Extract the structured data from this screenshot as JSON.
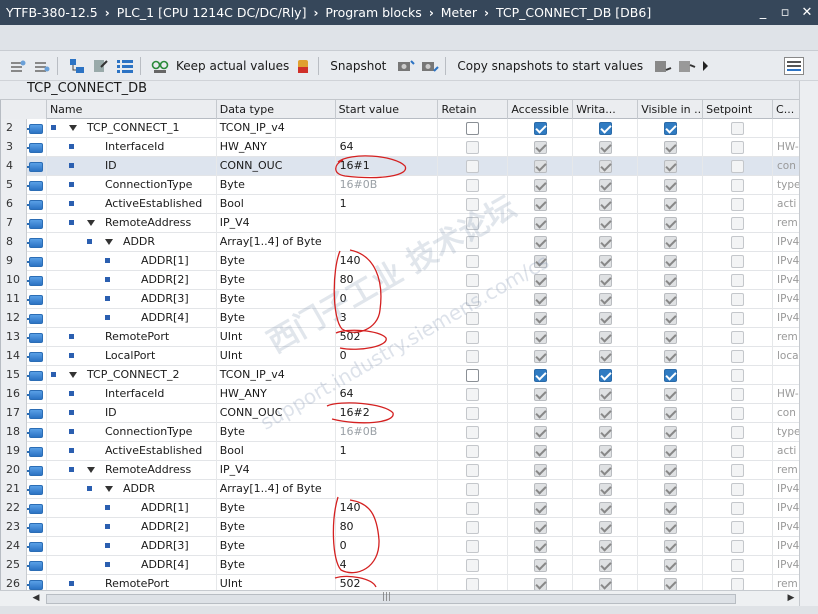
{
  "breadcrumb": [
    "YTFB-380-12.5",
    "PLC_1 [CPU 1214C DC/DC/Rly]",
    "Program blocks",
    "Meter",
    "TCP_CONNECT_DB [DB6]"
  ],
  "window_controls": {
    "minimize": "_",
    "restore": "▫",
    "close": "✕"
  },
  "toolbar": {
    "keep_actual": "Keep actual values",
    "snapshot": "Snapshot",
    "copy_snapshots": "Copy snapshots to start values"
  },
  "db_title": "TCP_CONNECT_DB",
  "columns": [
    "Name",
    "Data type",
    "Start value",
    "Retain",
    "Accessible f...",
    "Writa...",
    "Visible in ...",
    "Setpoint",
    "C..."
  ],
  "rows": [
    {
      "num": "2",
      "name": "TCP_CONNECT_1",
      "level": 0,
      "expand": true,
      "type": "TCON_IP_v4",
      "start": "",
      "grey": false,
      "retain": "box",
      "acc": "on",
      "wr": "on",
      "vis": "on",
      "set": "dis",
      "extra": ""
    },
    {
      "num": "3",
      "name": "InterfaceId",
      "level": 1,
      "expand": false,
      "type": "HW_ANY",
      "start": "64",
      "grey": false,
      "retain": "dis",
      "acc": "ondis",
      "wr": "ondis",
      "vis": "ondis",
      "set": "dis",
      "extra": "HW-"
    },
    {
      "num": "4",
      "name": "ID",
      "level": 1,
      "expand": false,
      "type": "CONN_OUC",
      "start": "16#1",
      "grey": false,
      "retain": "dis",
      "acc": "ondis",
      "wr": "ondis",
      "vis": "ondis",
      "set": "dis",
      "extra": "con",
      "sel": true
    },
    {
      "num": "5",
      "name": "ConnectionType",
      "level": 1,
      "expand": false,
      "type": "Byte",
      "start": "16#0B",
      "grey": true,
      "retain": "dis",
      "acc": "ondis",
      "wr": "ondis",
      "vis": "ondis",
      "set": "dis",
      "extra": "type"
    },
    {
      "num": "6",
      "name": "ActiveEstablished",
      "level": 1,
      "expand": false,
      "type": "Bool",
      "start": "1",
      "grey": false,
      "retain": "dis",
      "acc": "ondis",
      "wr": "ondis",
      "vis": "ondis",
      "set": "dis",
      "extra": "acti"
    },
    {
      "num": "7",
      "name": "RemoteAddress",
      "level": 1,
      "expand": true,
      "type": "IP_V4",
      "start": "",
      "grey": false,
      "retain": "dis",
      "acc": "ondis",
      "wr": "ondis",
      "vis": "ondis",
      "set": "dis",
      "extra": "rem"
    },
    {
      "num": "8",
      "name": "ADDR",
      "level": 2,
      "expand": true,
      "type": "Array[1..4] of Byte",
      "start": "",
      "grey": false,
      "retain": "dis",
      "acc": "ondis",
      "wr": "ondis",
      "vis": "ondis",
      "set": "dis",
      "extra": "IPv4"
    },
    {
      "num": "9",
      "name": "ADDR[1]",
      "level": 3,
      "expand": false,
      "type": "Byte",
      "start": "140",
      "grey": false,
      "retain": "dis",
      "acc": "ondis",
      "wr": "ondis",
      "vis": "ondis",
      "set": "dis",
      "extra": "IPv4"
    },
    {
      "num": "10",
      "name": "ADDR[2]",
      "level": 3,
      "expand": false,
      "type": "Byte",
      "start": "80",
      "grey": false,
      "retain": "dis",
      "acc": "ondis",
      "wr": "ondis",
      "vis": "ondis",
      "set": "dis",
      "extra": "IPv4"
    },
    {
      "num": "11",
      "name": "ADDR[3]",
      "level": 3,
      "expand": false,
      "type": "Byte",
      "start": "0",
      "grey": false,
      "retain": "dis",
      "acc": "ondis",
      "wr": "ondis",
      "vis": "ondis",
      "set": "dis",
      "extra": "IPv4"
    },
    {
      "num": "12",
      "name": "ADDR[4]",
      "level": 3,
      "expand": false,
      "type": "Byte",
      "start": "3",
      "grey": false,
      "retain": "dis",
      "acc": "ondis",
      "wr": "ondis",
      "vis": "ondis",
      "set": "dis",
      "extra": "IPv4"
    },
    {
      "num": "13",
      "name": "RemotePort",
      "level": 1,
      "expand": false,
      "type": "UInt",
      "start": "502",
      "grey": false,
      "retain": "dis",
      "acc": "ondis",
      "wr": "ondis",
      "vis": "ondis",
      "set": "dis",
      "extra": "rem"
    },
    {
      "num": "14",
      "name": "LocalPort",
      "level": 1,
      "expand": false,
      "type": "UInt",
      "start": "0",
      "grey": false,
      "retain": "dis",
      "acc": "ondis",
      "wr": "ondis",
      "vis": "ondis",
      "set": "dis",
      "extra": "loca"
    },
    {
      "num": "15",
      "name": "TCP_CONNECT_2",
      "level": 0,
      "expand": true,
      "type": "TCON_IP_v4",
      "start": "",
      "grey": false,
      "retain": "box",
      "acc": "on",
      "wr": "on",
      "vis": "on",
      "set": "dis",
      "extra": ""
    },
    {
      "num": "16",
      "name": "InterfaceId",
      "level": 1,
      "expand": false,
      "type": "HW_ANY",
      "start": "64",
      "grey": false,
      "retain": "dis",
      "acc": "ondis",
      "wr": "ondis",
      "vis": "ondis",
      "set": "dis",
      "extra": "HW-"
    },
    {
      "num": "17",
      "name": "ID",
      "level": 1,
      "expand": false,
      "type": "CONN_OUC",
      "start": "16#2",
      "grey": false,
      "retain": "dis",
      "acc": "ondis",
      "wr": "ondis",
      "vis": "ondis",
      "set": "dis",
      "extra": "con"
    },
    {
      "num": "18",
      "name": "ConnectionType",
      "level": 1,
      "expand": false,
      "type": "Byte",
      "start": "16#0B",
      "grey": true,
      "retain": "dis",
      "acc": "ondis",
      "wr": "ondis",
      "vis": "ondis",
      "set": "dis",
      "extra": "type"
    },
    {
      "num": "19",
      "name": "ActiveEstablished",
      "level": 1,
      "expand": false,
      "type": "Bool",
      "start": "1",
      "grey": false,
      "retain": "dis",
      "acc": "ondis",
      "wr": "ondis",
      "vis": "ondis",
      "set": "dis",
      "extra": "acti"
    },
    {
      "num": "20",
      "name": "RemoteAddress",
      "level": 1,
      "expand": true,
      "type": "IP_V4",
      "start": "",
      "grey": false,
      "retain": "dis",
      "acc": "ondis",
      "wr": "ondis",
      "vis": "ondis",
      "set": "dis",
      "extra": "rem"
    },
    {
      "num": "21",
      "name": "ADDR",
      "level": 2,
      "expand": true,
      "type": "Array[1..4] of Byte",
      "start": "",
      "grey": false,
      "retain": "dis",
      "acc": "ondis",
      "wr": "ondis",
      "vis": "ondis",
      "set": "dis",
      "extra": "IPv4"
    },
    {
      "num": "22",
      "name": "ADDR[1]",
      "level": 3,
      "expand": false,
      "type": "Byte",
      "start": "140",
      "grey": false,
      "retain": "dis",
      "acc": "ondis",
      "wr": "ondis",
      "vis": "ondis",
      "set": "dis",
      "extra": "IPv4"
    },
    {
      "num": "23",
      "name": "ADDR[2]",
      "level": 3,
      "expand": false,
      "type": "Byte",
      "start": "80",
      "grey": false,
      "retain": "dis",
      "acc": "ondis",
      "wr": "ondis",
      "vis": "ondis",
      "set": "dis",
      "extra": "IPv4"
    },
    {
      "num": "24",
      "name": "ADDR[3]",
      "level": 3,
      "expand": false,
      "type": "Byte",
      "start": "0",
      "grey": false,
      "retain": "dis",
      "acc": "ondis",
      "wr": "ondis",
      "vis": "ondis",
      "set": "dis",
      "extra": "IPv4"
    },
    {
      "num": "25",
      "name": "ADDR[4]",
      "level": 3,
      "expand": false,
      "type": "Byte",
      "start": "4",
      "grey": false,
      "retain": "dis",
      "acc": "ondis",
      "wr": "ondis",
      "vis": "ondis",
      "set": "dis",
      "extra": "IPv4"
    },
    {
      "num": "26",
      "name": "RemotePort",
      "level": 1,
      "expand": false,
      "type": "UInt",
      "start": "502",
      "grey": false,
      "retain": "dis",
      "acc": "ondis",
      "wr": "ondis",
      "vis": "ondis",
      "set": "dis",
      "extra": "rem"
    }
  ],
  "scroll_marker": "|||",
  "watermark": {
    "line1": "西门子工业  技术论坛",
    "line2": "support.industry.siemens.com/cs"
  },
  "colors": {
    "titlebar": "#36475a",
    "annotation": "#d42020",
    "checked": "#2f7bc2"
  },
  "icons": {
    "member": "db-member-icon",
    "expand": "triangle-expand-icon",
    "bullet": "square-bullet-icon"
  }
}
